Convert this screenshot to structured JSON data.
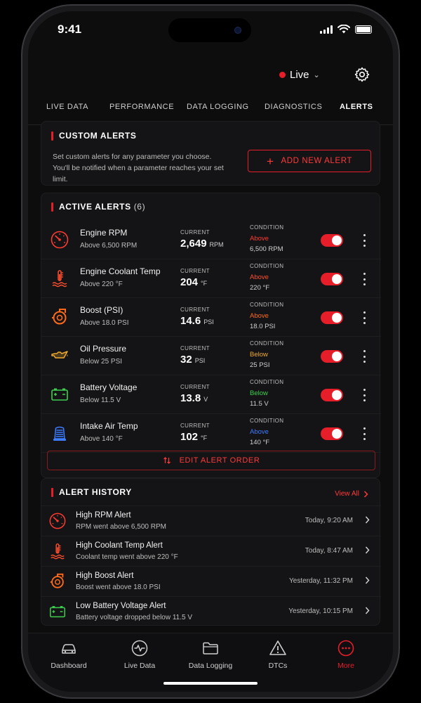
{
  "status_bar": {
    "time": "9:41"
  },
  "header": {
    "live_label": "Live"
  },
  "tabs": [
    {
      "label": "LIVE DATA"
    },
    {
      "label": "PERFORMANCE"
    },
    {
      "label": "DATA LOGGING"
    },
    {
      "label": "DIAGNOSTICS"
    },
    {
      "label": "ALERTS"
    }
  ],
  "active_tab": "ALERTS",
  "custom_alerts": {
    "title": "CUSTOM ALERTS",
    "description": "Set custom alerts for any parameter you choose. You'll be notified when a parameter reaches your set limit.",
    "add_button": "ADD NEW ALERT"
  },
  "active_alerts": {
    "title": "ACTIVE ALERTS",
    "count": "(6)",
    "current_label": "CURRENT",
    "condition_label": "CONDITION",
    "edit_button": "EDIT ALERT ORDER",
    "items": [
      {
        "icon": "tachometer-icon",
        "name": "Engine RPM",
        "sub": "Above 6,500 RPM",
        "current": "2,649",
        "unit": "RPM",
        "direction": "Above",
        "direction_color": "#ff3b30",
        "threshold": "6,500 RPM",
        "enabled": true
      },
      {
        "icon": "coolant-temp-icon",
        "name": "Engine Coolant Temp",
        "sub": "Above 220 °F",
        "current": "204",
        "unit": "°F",
        "direction": "Above",
        "direction_color": "#ff4f2e",
        "threshold": "220 °F",
        "enabled": true
      },
      {
        "icon": "turbo-icon",
        "name": "Boost (PSI)",
        "sub": "Above 18.0 PSI",
        "current": "14.6",
        "unit": "PSI",
        "direction": "Above",
        "direction_color": "#ff6a1a",
        "threshold": "18.0 PSI",
        "enabled": true
      },
      {
        "icon": "oil-can-icon",
        "name": "Oil Pressure",
        "sub": "Below 25 PSI",
        "current": "32",
        "unit": "PSI",
        "direction": "Below",
        "direction_color": "#f0a92f",
        "threshold": "25 PSI",
        "enabled": true
      },
      {
        "icon": "battery-icon",
        "name": "Battery Voltage",
        "sub": "Below 11.5 V",
        "current": "13.8",
        "unit": "V",
        "direction": "Below",
        "direction_color": "#3ccf4e",
        "threshold": "11.5 V",
        "enabled": true
      },
      {
        "icon": "air-filter-icon",
        "name": "Intake Air Temp",
        "sub": "Above 140 °F",
        "current": "102",
        "unit": "°F",
        "direction": "Above",
        "direction_color": "#3d7bff",
        "threshold": "140 °F",
        "enabled": true
      }
    ]
  },
  "alert_history": {
    "title": "ALERT HISTORY",
    "view_all": "View All",
    "items": [
      {
        "icon": "tachometer-icon",
        "name": "High RPM Alert",
        "sub": "RPM went above 6,500 RPM",
        "when": "Today, 9:20 AM"
      },
      {
        "icon": "coolant-temp-icon",
        "name": "High Coolant Temp Alert",
        "sub": "Coolant temp went above 220 °F",
        "when": "Today, 8:47 AM"
      },
      {
        "icon": "turbo-icon",
        "name": "High Boost Alert",
        "sub": "Boost went above 18.0 PSI",
        "when": "Yesterday, 11:32 PM"
      },
      {
        "icon": "battery-icon",
        "name": "Low Battery Voltage Alert",
        "sub": "Battery voltage dropped below 11.5 V",
        "when": "Yesterday, 10:15 PM"
      }
    ]
  },
  "bottom_nav": [
    {
      "icon": "car-icon",
      "label": "Dashboard"
    },
    {
      "icon": "pulse-icon",
      "label": "Live Data"
    },
    {
      "icon": "folder-icon",
      "label": "Data Logging"
    },
    {
      "icon": "warning-icon",
      "label": "DTCs"
    },
    {
      "icon": "more-icon",
      "label": "More"
    }
  ],
  "active_nav": "More",
  "colors": {
    "accent": "#e61e2a",
    "background": "#0d0d0e",
    "card": "#141416"
  }
}
